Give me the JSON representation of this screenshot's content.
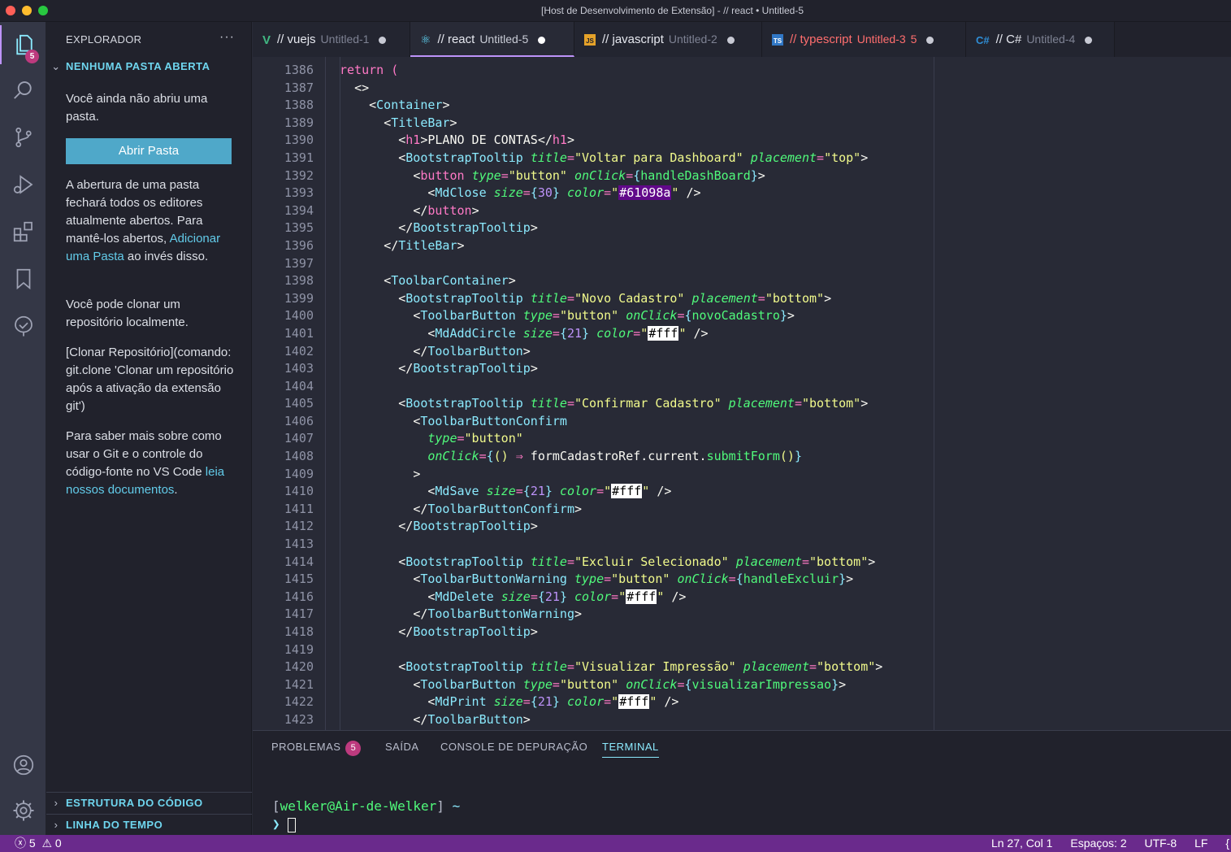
{
  "window": {
    "title": "[Host de Desenvolvimento de Extensão] - // react • Untitled-5"
  },
  "activity_bar": {
    "explorer_badge": "5"
  },
  "sidebar": {
    "header": "EXPLORADOR",
    "more": "···",
    "section_title": "NENHUMA PASTA ABERTA",
    "intro": "Você ainda não abriu uma pasta.",
    "open_button": "Abrir Pasta",
    "p2_before": "A abertura de uma pasta fechará todos os editores atualmente abertos. Para mantê-los abertos,",
    "p2_link": "Adicionar uma Pasta",
    "p2_after": "ao invés disso.",
    "p3": "Você pode clonar um repositório localmente.",
    "p4": "[Clonar Repositório](comando: git.clone 'Clonar um repositório após a ativação da extensão git')",
    "p5_before": "Para saber mais sobre como usar o Git e o controle do código-fonte no VS Code",
    "p5_link": "leia nossos documentos",
    "p5_after": ".",
    "outline": "ESTRUTURA DO CÓDIGO",
    "timeline": "LINHA DO TEMPO"
  },
  "tabs": [
    {
      "title": "// vuejs",
      "desc": "Untitled-1",
      "icon": "vue-icon",
      "icon_color": "#41b883"
    },
    {
      "title": "// react",
      "desc": "Untitled-5",
      "icon": "react-icon",
      "icon_color": "#61dafb"
    },
    {
      "title": "// javascript",
      "desc": "Untitled-2",
      "icon": "js-icon",
      "icon_color": "#e5a229"
    },
    {
      "title": "// typescript",
      "desc": "Untitled-3",
      "count": "5",
      "icon": "ts-icon",
      "icon_color": "#3178c6"
    },
    {
      "title": "// C#",
      "desc": "Untitled-4",
      "icon": "csharp-icon",
      "icon_color": "#2f8ed6"
    }
  ],
  "editor": {
    "line_numbers": [
      "1386",
      "1387",
      "1388",
      "1389",
      "1390",
      "1391",
      "1392",
      "1393",
      "1394",
      "1395",
      "1396",
      "1397",
      "1398",
      "1399",
      "1400",
      "1401",
      "1402",
      "1403",
      "1404",
      "1405",
      "1406",
      "1407",
      "1408",
      "1409",
      "1410",
      "1411",
      "1412",
      "1413",
      "1414",
      "1415",
      "1416",
      "1417",
      "1418",
      "1419",
      "1420",
      "1421",
      "1422",
      "1423"
    ]
  },
  "panel": {
    "tabs": [
      "PROBLEMAS",
      "SAÍDA",
      "CONSOLE DE DEPURAÇÃO",
      "TERMINAL"
    ],
    "problems_count": "5",
    "terminal_user": "welker@Air-de-Welker",
    "terminal_dir": "~",
    "terminal_prompt": "❯"
  },
  "statusbar": {
    "errors": "5",
    "warnings": "0",
    "position": "Ln 27, Col 1",
    "spaces": "Espaços: 2",
    "encoding": "UTF-8",
    "eol": "LF",
    "lang": "{"
  },
  "colors": {
    "accent": "#bd93f9",
    "status_bar": "#6a2a8c",
    "badge": "#bd3a7e",
    "button": "#4fa8c9"
  }
}
